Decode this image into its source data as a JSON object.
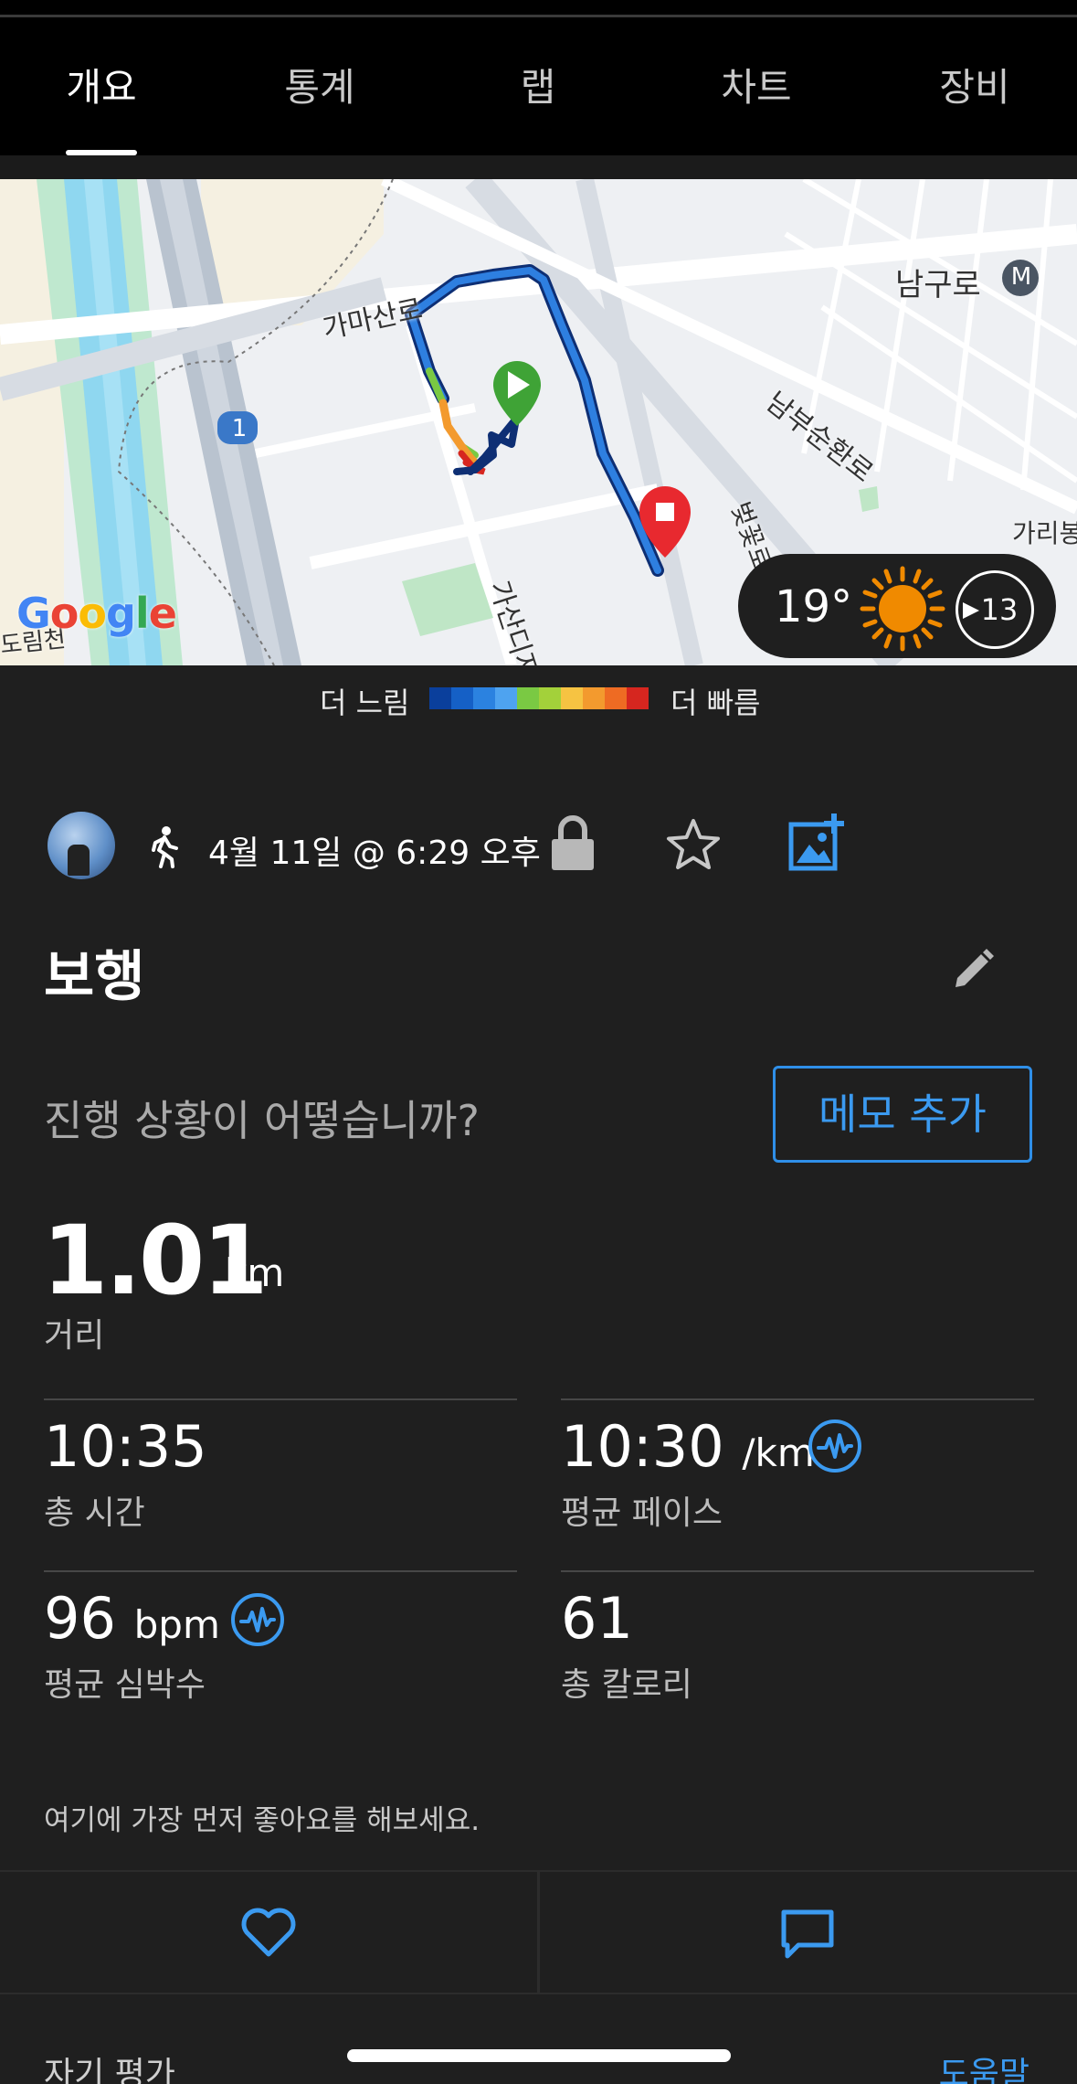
{
  "tabs": [
    {
      "label": "개요",
      "active": true
    },
    {
      "label": "통계",
      "active": false
    },
    {
      "label": "랩",
      "active": false
    },
    {
      "label": "차트",
      "active": false
    },
    {
      "label": "장비",
      "active": false
    }
  ],
  "map": {
    "labels": {
      "road1": "가마산로",
      "district": "남구로",
      "road2": "남부순환로",
      "road3": "벚꽃로",
      "road4": "가산디지",
      "area1": "가리봉",
      "area2": "도림천",
      "route_marker": "1",
      "metro": "M"
    },
    "attribution": "Google"
  },
  "weather": {
    "temperature": "19°",
    "wind": "13",
    "icon": "sun-icon"
  },
  "legend": {
    "slow_label": "더 느림",
    "fast_label": "더 빠름",
    "colors": [
      "#0a3f9c",
      "#1560c6",
      "#2b82e0",
      "#4ea3f0",
      "#7ac943",
      "#a3d13a",
      "#f6c342",
      "#f39a2e",
      "#ee6b23",
      "#d6261f"
    ]
  },
  "activity": {
    "type_icon": "walk-icon",
    "datetime": "4월 11일 @ 6:29 오후",
    "title": "보행",
    "question": "진행 상황이 어떻습니까?",
    "memo_button": "메모 추가"
  },
  "distance": {
    "value": "1.01",
    "unit": "km",
    "label": "거리"
  },
  "stats": [
    {
      "value": "10:35",
      "unit": "",
      "label": "총 시간"
    },
    {
      "value": "10:30",
      "unit": "/km",
      "label": "평균 페이스"
    },
    {
      "value": "96",
      "unit": "bpm",
      "label": "평균 심박수"
    },
    {
      "value": "61",
      "unit": "",
      "label": "총 칼로리"
    }
  ],
  "social": {
    "like_prompt": "여기에 가장 먼저 좋아요를 해보세요."
  },
  "footer": {
    "self_evaluation": "자기 평가",
    "help": "도움말"
  },
  "colors": {
    "accent": "#3b9af0",
    "background": "#1f1f1f",
    "start_marker": "#3fa336",
    "end_marker": "#e8292f",
    "sun": "#f08a00"
  }
}
